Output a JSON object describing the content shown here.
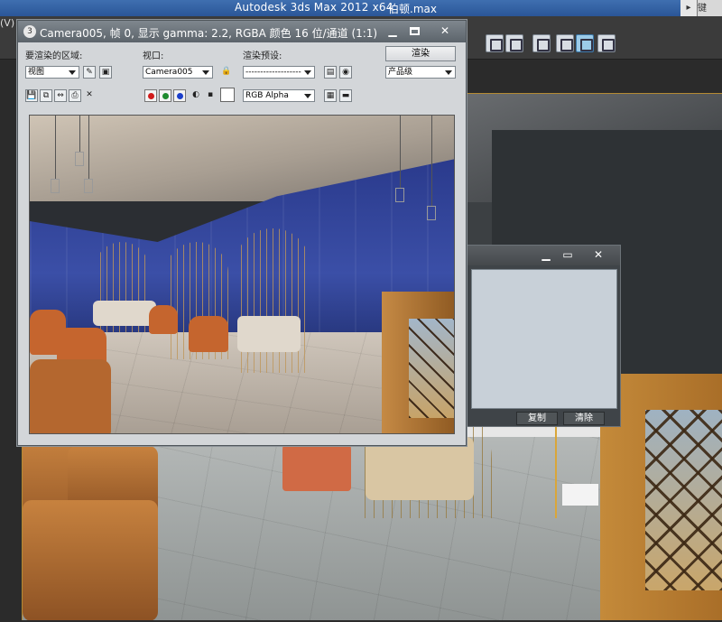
{
  "app": {
    "title": "Autodesk 3ds Max  2012 x64",
    "file": "伯顿.max",
    "menu_fragment": "(V)",
    "help_fragment": "键"
  },
  "frame_window": {
    "title": "Camera005, 帧 0, 显示 gamma: 2.2, RGBA 颜色 16 位/通道 (1:1)",
    "area_label": "要渲染的区域:",
    "area_value": "视图",
    "viewport_label": "视口:",
    "viewport_value": "Camera005",
    "preset_label": "渲染预设:",
    "preset_value": "-------------------",
    "render_button": "渲染",
    "quality_value": "产品级",
    "channel_value": "RGB Alpha"
  },
  "aux_window": {
    "copy_button": "复制",
    "clear_button": "清除"
  },
  "icons": {
    "minimize": "minimize-icon",
    "maximize": "maximize-icon",
    "close": "close-icon"
  }
}
